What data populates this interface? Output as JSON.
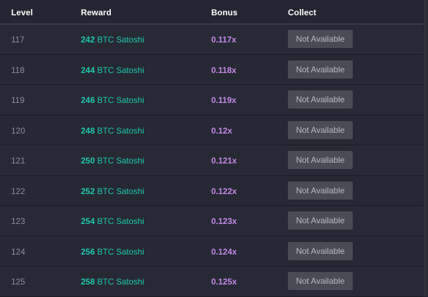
{
  "header": {
    "level": "Level",
    "reward": "Reward",
    "bonus": "Bonus",
    "collect": "Collect"
  },
  "rows": [
    {
      "level": "117",
      "amount": "242",
      "currency": "BTC Satoshi",
      "bonus": "0.117x",
      "collect": "Not Available"
    },
    {
      "level": "118",
      "amount": "244",
      "currency": "BTC Satoshi",
      "bonus": "0.118x",
      "collect": "Not Available"
    },
    {
      "level": "119",
      "amount": "246",
      "currency": "BTC Satoshi",
      "bonus": "0.119x",
      "collect": "Not Available"
    },
    {
      "level": "120",
      "amount": "248",
      "currency": "BTC Satoshi",
      "bonus": "0.12x",
      "collect": "Not Available"
    },
    {
      "level": "121",
      "amount": "250",
      "currency": "BTC Satoshi",
      "bonus": "0.121x",
      "collect": "Not Available"
    },
    {
      "level": "122",
      "amount": "252",
      "currency": "BTC Satoshi",
      "bonus": "0.122x",
      "collect": "Not Available"
    },
    {
      "level": "123",
      "amount": "254",
      "currency": "BTC Satoshi",
      "bonus": "0.123x",
      "collect": "Not Available"
    },
    {
      "level": "124",
      "amount": "256",
      "currency": "BTC Satoshi",
      "bonus": "0.124x",
      "collect": "Not Available"
    },
    {
      "level": "125",
      "amount": "258",
      "currency": "BTC Satoshi",
      "bonus": "0.125x",
      "collect": "Not Available"
    }
  ],
  "colors": {
    "background": "#232530",
    "reward": "#1ec8b0",
    "bonus": "#c689e8",
    "button": "#4a4c55"
  }
}
